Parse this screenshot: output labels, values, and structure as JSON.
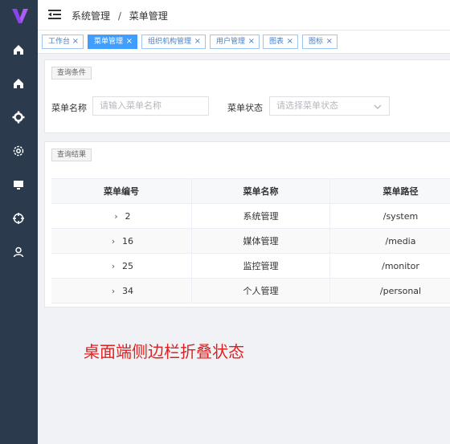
{
  "header": {
    "breadcrumb": [
      "系统管理",
      "菜单管理"
    ],
    "separator": "/"
  },
  "tags": [
    {
      "label": "工作台",
      "active": false
    },
    {
      "label": "菜单管理",
      "active": true
    },
    {
      "label": "组织机构管理",
      "active": false
    },
    {
      "label": "用户管理",
      "active": false
    },
    {
      "label": "图表",
      "active": false
    },
    {
      "label": "图标",
      "active": false
    }
  ],
  "tag_close": "×",
  "query": {
    "tab_label": "查询条件",
    "menu_name_label": "菜单名称",
    "menu_name_placeholder": "请输入菜单名称",
    "menu_status_label": "菜单状态",
    "menu_status_placeholder": "请选择菜单状态"
  },
  "results": {
    "tab_label": "查询结果",
    "columns": [
      "菜单编号",
      "菜单名称",
      "菜单路径"
    ],
    "rows": [
      {
        "id": "2",
        "name": "系统管理",
        "path": "/system"
      },
      {
        "id": "16",
        "name": "媒体管理",
        "path": "/media"
      },
      {
        "id": "25",
        "name": "监控管理",
        "path": "/monitor"
      },
      {
        "id": "34",
        "name": "个人管理",
        "path": "/personal"
      }
    ],
    "expand_glyph": "›"
  },
  "annotation": "桌面端侧边栏折叠状态",
  "colors": {
    "sidebar_bg": "#2b3a4d",
    "accent": "#409eff",
    "logo": "#8e44ec",
    "annotation": "#e02020"
  },
  "icons": [
    "logo-icon",
    "home-icon",
    "home-icon",
    "settings-icon",
    "gear-icon",
    "monitor-icon",
    "target-icon",
    "user-icon"
  ]
}
